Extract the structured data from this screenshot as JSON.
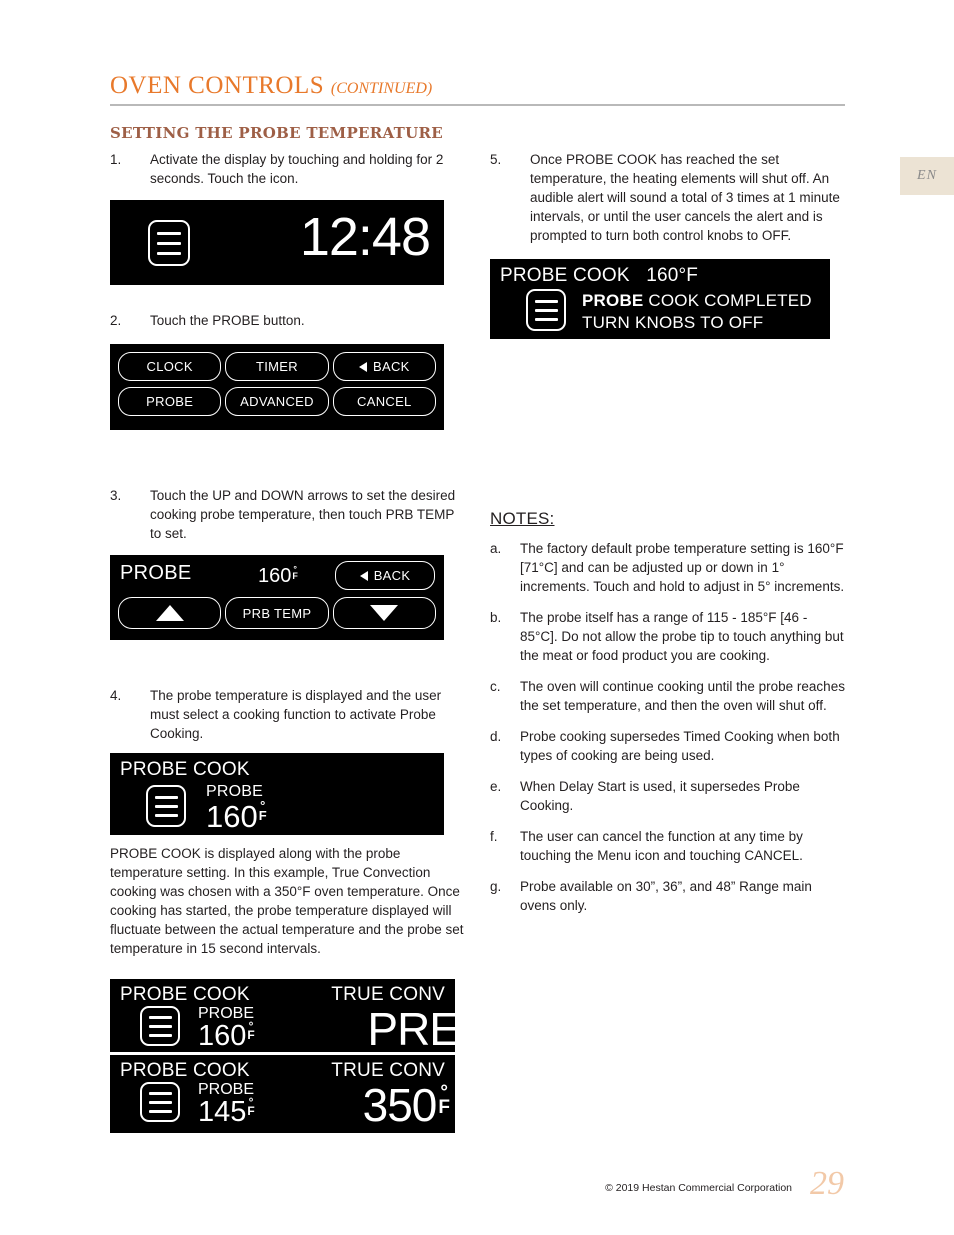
{
  "header": {
    "title": "OVEN CONTROLS",
    "title_continued": "(CONTINUED)",
    "subheading": "SETTING THE PROBE TEMPERATURE",
    "language_tab": "EN",
    "accent_color": "#E8792B",
    "subheading_color": "#9E5F46"
  },
  "left_column": {
    "steps": [
      {
        "num": "1.",
        "text": "Activate the display by touching and holding for 2 seconds.  Touch the icon."
      },
      {
        "num": "2.",
        "text": "Touch the PROBE button."
      },
      {
        "num": "3.",
        "text": "Touch the UP and DOWN arrows to set the desired cooking probe temperature, then touch PRB TEMP to set."
      },
      {
        "num": "4.",
        "text": "The probe temperature is displayed and the user must select a cooking function to activate Probe Cooking."
      }
    ],
    "paragraph": "PROBE COOK is displayed along with the probe temperature setting.  In this example, True Convection cooking was chosen with a 350°F oven temperature.  Once cooking has started, the probe temperature displayed will fluctuate between the actual temperature and the probe set temperature in 15 second intervals."
  },
  "displays": {
    "clock": {
      "menu_icon": "menu-icon",
      "time": "12:48"
    },
    "keypad": {
      "buttons": [
        {
          "label": "CLOCK",
          "icon": ""
        },
        {
          "label": "TIMER",
          "icon": ""
        },
        {
          "label": "BACK",
          "icon": "back-arrow-icon"
        },
        {
          "label": "PROBE",
          "icon": ""
        },
        {
          "label": "ADVANCED",
          "icon": ""
        },
        {
          "label": "CANCEL",
          "icon": ""
        }
      ]
    },
    "probe_set": {
      "label": "PROBE",
      "temperature": "160",
      "degree": "°",
      "unit": "F",
      "back_label": "BACK",
      "up_label": "up-arrow-icon",
      "set_label": "PRB TEMP",
      "down_label": "down-arrow-icon"
    },
    "probe_cook": {
      "title": "PROBE COOK",
      "sub_label": "PROBE",
      "temperature": "160",
      "degree": "°",
      "unit": "F"
    },
    "probe_cook_preheat": {
      "left_title": "PROBE COOK",
      "right_title": "TRUE CONV",
      "sub_label": "PROBE",
      "temperature": "160",
      "degree": "°",
      "unit": "F",
      "status": "PRE"
    },
    "probe_cook_running": {
      "left_title": "PROBE COOK",
      "right_title": "TRUE CONV",
      "sub_label": "PROBE",
      "temperature": "145",
      "degree": "°",
      "unit": "F",
      "oven_temperature": "350",
      "oven_degree": "°",
      "oven_unit": "F"
    },
    "probe_completed": {
      "header_label": "PROBE COOK",
      "header_temperature": "160°F",
      "line1_bold": "PROBE",
      "line1_rest": " COOK COMPLETED",
      "line2": "TURN KNOBS TO OFF"
    }
  },
  "right_column": {
    "step": {
      "num": "5.",
      "text": "Once PROBE COOK has reached the set temperature, the heating elements will shut off.  An audible alert will sound a total of 3 times at 1 minute intervals, or until the user cancels the alert and is prompted to turn both control knobs to OFF."
    },
    "notes_title": "NOTES:",
    "notes": [
      {
        "label": "a.",
        "text": "The factory default probe temperature setting is 160°F [71°C] and can be adjusted up or down in 1° increments.  Touch and hold to adjust in 5° increments."
      },
      {
        "label": "b.",
        "text": "The probe itself has a range of 115 - 185°F [46 - 85°C].  Do not allow the probe tip to touch anything but the meat or food product you are cooking."
      },
      {
        "label": "c.",
        "text": "The oven will continue cooking until the probe reaches the set temperature, and then the oven will shut off."
      },
      {
        "label": "d.",
        "text": "Probe cooking supersedes Timed Cooking when both types of cooking are being used."
      },
      {
        "label": "e.",
        "text": "When Delay Start is used, it supersedes Probe Cooking."
      },
      {
        "label": "f.",
        "text": "The user can cancel the function at any time by touching the Menu icon and touching CANCEL."
      },
      {
        "label": "g.",
        "text": "Probe available on 30”, 36”, and 48” Range main ovens only."
      }
    ]
  },
  "footer": {
    "copyright": "© 2019 Hestan Commercial Corporation",
    "page_number": "29"
  }
}
